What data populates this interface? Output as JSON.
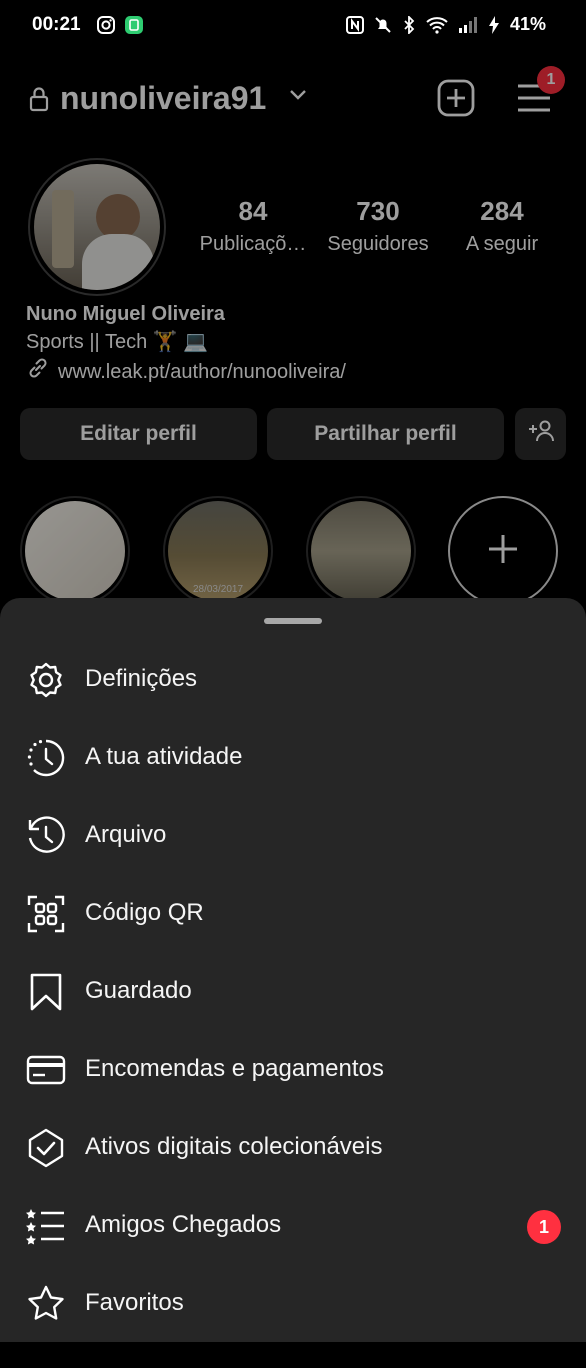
{
  "status": {
    "time": "00:21",
    "battery": "41%"
  },
  "header": {
    "username": "nunoliveira91",
    "menu_badge": "1"
  },
  "stats": [
    {
      "num": "84",
      "label": "Publicaçõ…"
    },
    {
      "num": "730",
      "label": "Seguidores"
    },
    {
      "num": "284",
      "label": "A seguir"
    }
  ],
  "bio": {
    "name": "Nuno Miguel Oliveira",
    "tagline": "Sports || Tech 🏋 💻",
    "link": "www.leak.pt/author/nunooliveira/"
  },
  "buttons": {
    "edit": "Editar perfil",
    "share": "Partilhar perfil"
  },
  "stories": {
    "date_label": "28/03/2017"
  },
  "menu": {
    "items": [
      {
        "label": "Definições",
        "icon": "gear-icon"
      },
      {
        "label": "A tua atividade",
        "icon": "activity-icon"
      },
      {
        "label": "Arquivo",
        "icon": "archive-icon"
      },
      {
        "label": "Código QR",
        "icon": "qr-code-icon"
      },
      {
        "label": "Guardado",
        "icon": "bookmark-icon"
      },
      {
        "label": "Encomendas e pagamentos",
        "icon": "card-icon"
      },
      {
        "label": "Ativos digitais colecionáveis",
        "icon": "shield-check-icon"
      },
      {
        "label": "Amigos Chegados",
        "icon": "close-friends-list-icon",
        "badge": "1"
      },
      {
        "label": "Favoritos",
        "icon": "star-icon"
      }
    ]
  },
  "colors": {
    "sheet": "#262626",
    "badge": "#ff3040",
    "button": "#2a2a2a"
  }
}
